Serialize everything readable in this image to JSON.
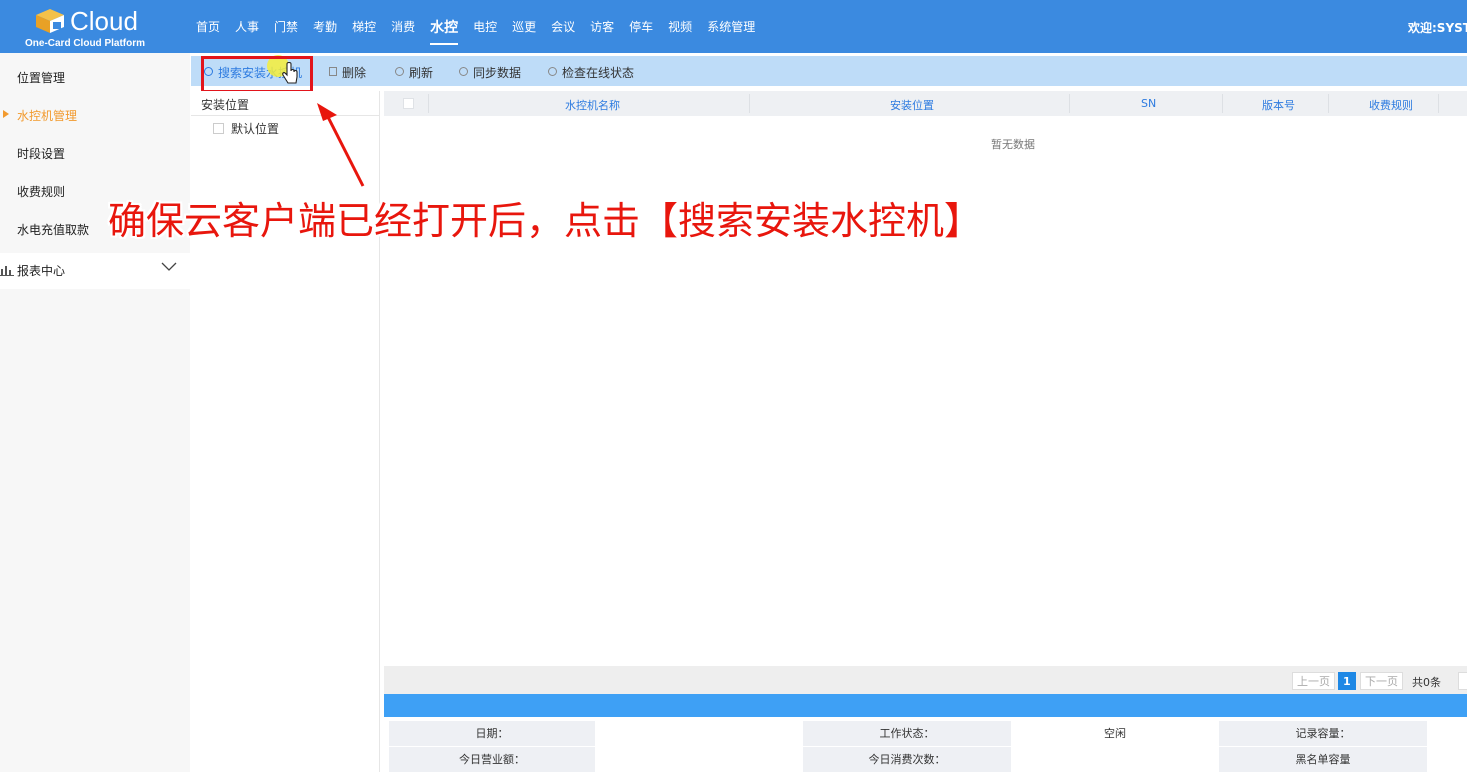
{
  "header": {
    "logo_title": "Cloud",
    "logo_subtitle": "One-Card Cloud Platform",
    "welcome": "欢迎:SYST",
    "nav": [
      {
        "label": "首页",
        "active": false
      },
      {
        "label": "人事",
        "active": false
      },
      {
        "label": "门禁",
        "active": false
      },
      {
        "label": "考勤",
        "active": false
      },
      {
        "label": "梯控",
        "active": false
      },
      {
        "label": "消费",
        "active": false
      },
      {
        "label": "水控",
        "active": true
      },
      {
        "label": "电控",
        "active": false
      },
      {
        "label": "巡更",
        "active": false
      },
      {
        "label": "会议",
        "active": false
      },
      {
        "label": "访客",
        "active": false
      },
      {
        "label": "停车",
        "active": false
      },
      {
        "label": "视频",
        "active": false
      },
      {
        "label": "系统管理",
        "active": false
      }
    ]
  },
  "sidebar": {
    "items": [
      {
        "label": "位置管理"
      },
      {
        "label": "水控机管理",
        "active": true
      },
      {
        "label": "时段设置"
      },
      {
        "label": "收费规则"
      },
      {
        "label": "水电充值取款"
      }
    ],
    "report": "报表中心"
  },
  "toolbar": {
    "search": "搜索安装水控机",
    "delete": "删除",
    "refresh": "刷新",
    "sync": "同步数据",
    "check": "检查在线状态"
  },
  "tree": {
    "header": "安装位置",
    "node": "默认位置"
  },
  "table": {
    "columns": [
      "水控机名称",
      "安装位置",
      "SN",
      "版本号",
      "收费规则"
    ],
    "empty": "暂无数据"
  },
  "pager": {
    "prev": "上一页",
    "current": "1",
    "next": "下一页",
    "total": "共0条"
  },
  "info": {
    "date_label": "日期：",
    "status_label": "工作状态：",
    "status_value": "空闲",
    "records_label": "记录容量：",
    "revenue_label": "今日营业额：",
    "count_label": "今日消费次数：",
    "blacklist_label": "黑名单容量"
  },
  "annotation": {
    "text": "确保云客户端已经打开后，点击【搜索安装水控机】",
    "color": "#e8160d"
  },
  "colors": {
    "header": "#3b8ae0",
    "accent": "#f29a2e",
    "toolbar": "#bedcf8",
    "highlight": "#e2141b"
  }
}
